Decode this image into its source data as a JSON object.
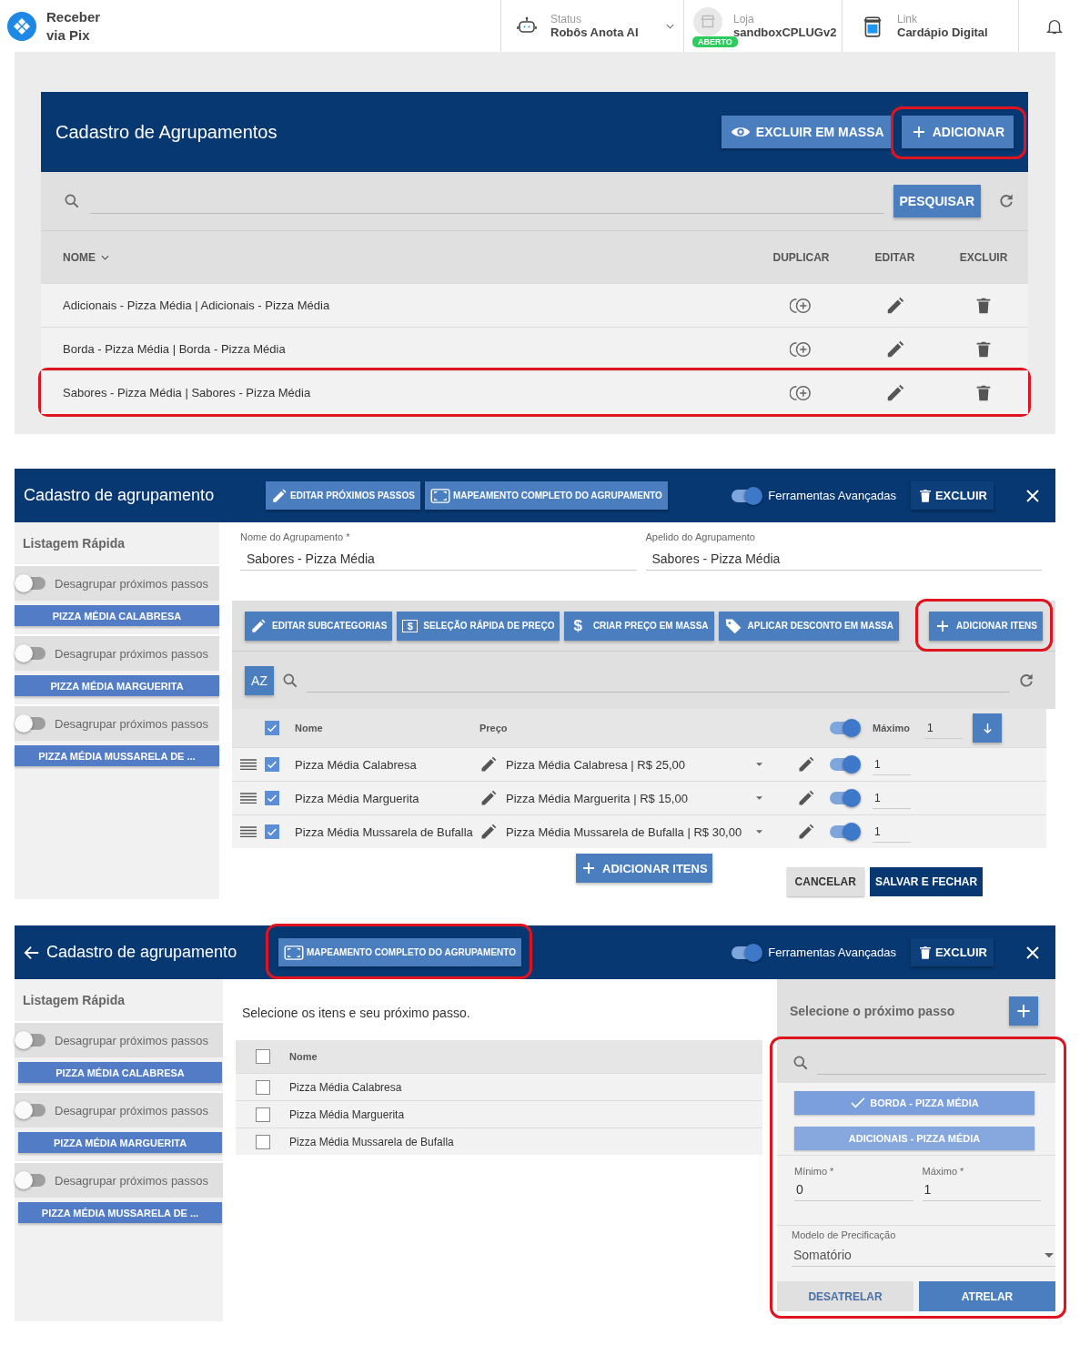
{
  "topbar": {
    "brand": "Receber via Pix",
    "status": {
      "label": "Status",
      "value": "Robôs Anota AI"
    },
    "store": {
      "label": "Loja",
      "value": "sandboxCPLUGv2",
      "badge": "ABERTO"
    },
    "link": {
      "label": "Link",
      "value": "Cardápio Digital"
    }
  },
  "groupings": {
    "title": "Cadastro de Agrupamentos",
    "actions": [
      {
        "label": "EXCLUIR EM MASSA",
        "highlighted": false
      },
      {
        "label": "ADICIONAR",
        "highlighted": true
      }
    ],
    "search_button": "PESQUISAR",
    "columns": [
      "NOME",
      "DUPLICAR",
      "EDITAR",
      "EXCLUIR"
    ],
    "rows": [
      {
        "name": "Adicionais - Pizza Média | Adicionais - Pizza Média",
        "highlighted": false
      },
      {
        "name": "Borda - Pizza Média | Borda - Pizza Média",
        "highlighted": false
      },
      {
        "name": "Sabores - Pizza Média | Sabores - Pizza Média",
        "highlighted": true
      }
    ]
  },
  "editor": {
    "title": "Cadastro de agrupamento",
    "header_buttons": [
      {
        "label": "EDITAR PRÓXIMOS PASSOS",
        "highlighted": false
      },
      {
        "label": "MAPEAMENTO COMPLETO DO AGRUPAMENTO",
        "highlighted": false
      }
    ],
    "advanced_tools": {
      "label": "Ferramentas Avançadas",
      "on": true
    },
    "delete_button": "EXCLUIR",
    "sidebar": {
      "title": "Listagem Rápida",
      "groups": [
        {
          "toggle_label": "Desagrupar próximos passos",
          "on": false,
          "item": "PIZZA MÉDIA CALABRESA"
        },
        {
          "toggle_label": "Desagrupar próximos passos",
          "on": false,
          "item": "PIZZA MÉDIA MARGUERITA"
        },
        {
          "toggle_label": "Desagrupar próximos passos",
          "on": false,
          "item": "PIZZA MÉDIA MUSSARELA DE ..."
        }
      ]
    },
    "fields": [
      {
        "label": "Nome do Agrupamento *",
        "value": "Sabores - Pizza Média"
      },
      {
        "label": "Apelido do Agrupamento",
        "value": "Sabores - Pizza Média"
      }
    ],
    "toolbar": [
      {
        "label": "EDITAR SUBCATEGORIAS",
        "highlighted": false
      },
      {
        "label": "SELEÇÃO RÁPIDA DE PREÇO",
        "icon_char": "$",
        "highlighted": false
      },
      {
        "label": "CRIAR PREÇO EM MASSA",
        "icon_char": "$",
        "highlighted": false
      },
      {
        "label": "APLICAR DESCONTO EM MASSA",
        "highlighted": false
      },
      {
        "label": "ADICIONAR ITENS",
        "highlighted": true
      }
    ],
    "sort_button": "AZ",
    "table": {
      "all_checked": true,
      "columns": [
        "Nome",
        "Preço",
        "Máximo"
      ],
      "max_toggle_on": true,
      "max_value": "1",
      "rows": [
        {
          "checked": true,
          "name": "Pizza Média Calabresa",
          "price": "Pizza Média Calabresa | R$ 25,00",
          "max_on": true,
          "max": "1"
        },
        {
          "checked": true,
          "name": "Pizza Média Marguerita",
          "price": "Pizza Média Marguerita | R$ 15,00",
          "max_on": true,
          "max": "1"
        },
        {
          "checked": true,
          "name": "Pizza Média Mussarela de Bufalla",
          "price": "Pizza Média Mussarela de Bufalla | R$ 30,00",
          "max_on": true,
          "max": "1"
        }
      ]
    },
    "footer": {
      "add_button": "ADICIONAR ITENS",
      "cancel": "CANCELAR",
      "save": "SALVAR E FECHAR"
    }
  },
  "mapping": {
    "title": "Cadastro de agrupamento",
    "map_button": {
      "label": "MAPEAMENTO COMPLETO DO AGRUPAMENTO",
      "highlighted": true
    },
    "advanced_tools": {
      "label": "Ferramentas Avançadas",
      "on": true
    },
    "delete_button": "EXCLUIR",
    "sidebar": {
      "title": "Listagem Rápida",
      "groups": [
        {
          "toggle_label": "Desagrupar próximos passos",
          "on": false,
          "item": "PIZZA MÉDIA CALABRESA"
        },
        {
          "toggle_label": "Desagrupar próximos passos",
          "on": false,
          "item": "PIZZA MÉDIA MARGUERITA"
        },
        {
          "toggle_label": "Desagrupar próximos passos",
          "on": false,
          "item": "PIZZA MÉDIA MUSSARELA DE ..."
        }
      ]
    },
    "instruction": "Selecione os itens e seu próximo passo.",
    "table": {
      "all_checked": false,
      "column": "Nome",
      "rows": [
        {
          "checked": false,
          "name": "Pizza Média Calabresa"
        },
        {
          "checked": false,
          "name": "Pizza Média Marguerita"
        },
        {
          "checked": false,
          "name": "Pizza Média Mussarela de Bufalla"
        }
      ]
    },
    "next_step": {
      "title": "Selecione o próximo passo",
      "highlighted": true,
      "options": [
        {
          "label": "BORDA - PIZZA MÉDIA",
          "selected": true
        },
        {
          "label": "ADICIONAIS - PIZZA MÉDIA",
          "selected": false
        }
      ],
      "min": {
        "label": "Mínimo *",
        "value": "0"
      },
      "max": {
        "label": "Máximo *",
        "value": "1"
      },
      "pricing": {
        "label": "Modelo de Precificação",
        "value": "Somatório"
      },
      "buttons": [
        "DESATRELAR",
        "ATRELAR"
      ]
    }
  }
}
